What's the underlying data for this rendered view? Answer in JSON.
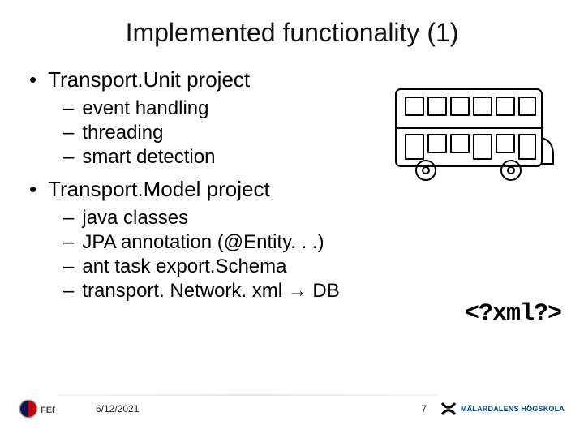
{
  "title": "Implemented functionality (1)",
  "sections": [
    {
      "heading": "Transport.Unit project",
      "items": [
        "event handling",
        "threading",
        "smart detection"
      ]
    },
    {
      "heading": "Transport.Model project",
      "items": [
        "java classes",
        "JPA annotation (@Entity. . .)",
        "ant task export.Schema",
        "transport. Network. xml → DB"
      ]
    }
  ],
  "xml_snippet": "<?xml?>",
  "footer": {
    "date": "6/12/2021",
    "page": "7",
    "left_logo_alt": "FER",
    "right_logo_alt": "MÄLARDALENS HÖGSKOLA"
  }
}
